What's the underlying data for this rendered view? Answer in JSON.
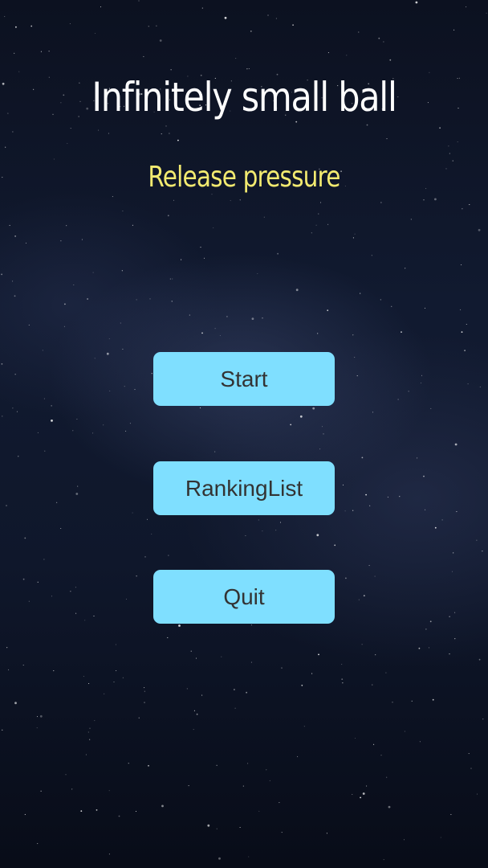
{
  "title": "Infinitely small ball",
  "subtitle": "Release pressure",
  "menu": {
    "start_label": "Start",
    "ranking_label": "RankingList",
    "quit_label": "Quit"
  },
  "colors": {
    "background": "#0f172b",
    "title": "#ffffff",
    "subtitle": "#f2ea70",
    "button_bg": "#7fdfff",
    "button_text": "#333333"
  }
}
